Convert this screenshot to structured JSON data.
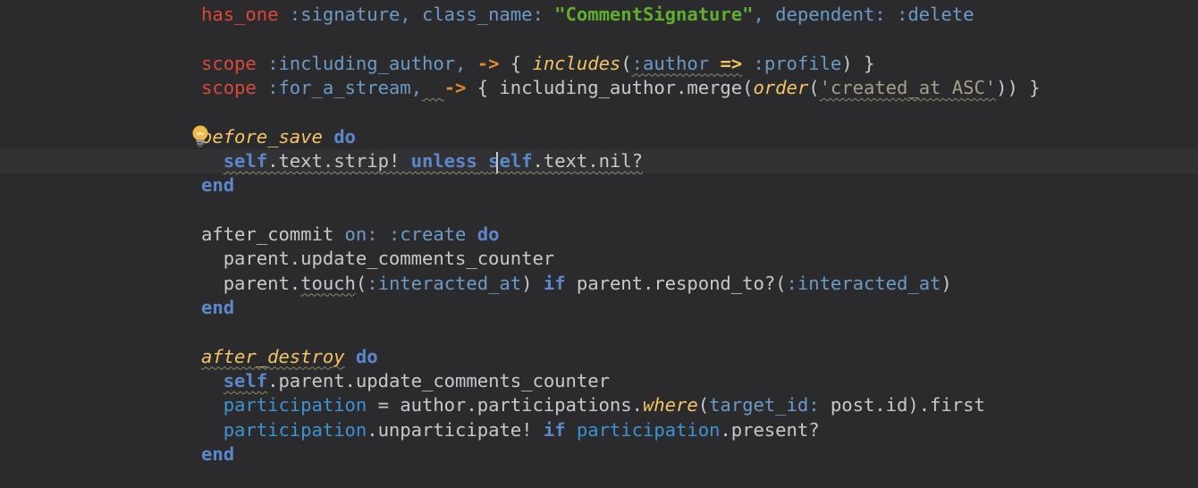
{
  "editor": {
    "current_line": 6,
    "lines": [
      [
        {
          "t": "has_one",
          "c": "kw"
        },
        {
          "t": " :signature, class_name: ",
          "c": "sym"
        },
        {
          "t": "\"CommentSignature\"",
          "c": "str"
        },
        {
          "t": ", dependent: :delete",
          "c": "sym"
        }
      ],
      [],
      [
        {
          "t": "scope",
          "c": "kw"
        },
        {
          "t": " :including_author, ",
          "c": "sym"
        },
        {
          "t": "->",
          "c": "arrow"
        },
        {
          "t": " { ",
          "c": "txt"
        },
        {
          "t": "includes",
          "c": "meth"
        },
        {
          "t": "(",
          "c": "txt"
        },
        {
          "t": ":author ",
          "c": "sym wavy"
        },
        {
          "t": "=>",
          "c": "fat wavy"
        },
        {
          "t": " :profile",
          "c": "sym"
        },
        {
          "t": ") }",
          "c": "txt"
        }
      ],
      [
        {
          "t": "scope",
          "c": "kw"
        },
        {
          "t": " :for_a_stream,",
          "c": "sym"
        },
        {
          "t": "  ",
          "c": "txt wavy"
        },
        {
          "t": "->",
          "c": "arrow"
        },
        {
          "t": " { including_author.merge(",
          "c": "txt"
        },
        {
          "t": "order",
          "c": "meth"
        },
        {
          "t": "(",
          "c": "txt"
        },
        {
          "t": "'created_at ASC'",
          "c": "sq wavy"
        },
        {
          "t": ")) }",
          "c": "txt"
        }
      ],
      [],
      [
        {
          "t": "before_save",
          "c": "meth"
        },
        {
          "t": " ",
          "c": "txt"
        },
        {
          "t": "do",
          "c": "bkw"
        }
      ],
      [
        {
          "t": "  ",
          "c": "txt"
        },
        {
          "t": "self",
          "c": "bkw wavy"
        },
        {
          "t": ".text.strip! ",
          "c": "txt wavy"
        },
        {
          "t": "unless",
          "c": "bkw wavy"
        },
        {
          "t": " ",
          "c": "txt wavy"
        },
        {
          "t": "self",
          "c": "bkw wavy"
        },
        {
          "t": ".text.nil?",
          "c": "txt wavy"
        }
      ],
      [
        {
          "t": "end",
          "c": "bkw"
        }
      ],
      [],
      [
        {
          "t": "after_commit ",
          "c": "txt"
        },
        {
          "t": "on:",
          "c": "sym"
        },
        {
          "t": " :create ",
          "c": "sym"
        },
        {
          "t": "do",
          "c": "bkw"
        }
      ],
      [
        {
          "t": "  parent.update_comments_counter",
          "c": "txt"
        }
      ],
      [
        {
          "t": "  parent.",
          "c": "txt"
        },
        {
          "t": "touch",
          "c": "txt wavy"
        },
        {
          "t": "(",
          "c": "txt"
        },
        {
          "t": ":interacted_at",
          "c": "sym"
        },
        {
          "t": ") ",
          "c": "txt"
        },
        {
          "t": "if",
          "c": "bkw"
        },
        {
          "t": " parent.respond_to?(",
          "c": "txt"
        },
        {
          "t": ":interacted_at",
          "c": "sym"
        },
        {
          "t": ")",
          "c": "txt"
        }
      ],
      [
        {
          "t": "end",
          "c": "bkw"
        }
      ],
      [],
      [
        {
          "t": "after_destroy",
          "c": "meth wavy"
        },
        {
          "t": " ",
          "c": "txt"
        },
        {
          "t": "do",
          "c": "bkw"
        }
      ],
      [
        {
          "t": "  ",
          "c": "txt"
        },
        {
          "t": "self",
          "c": "bkw wavy"
        },
        {
          "t": ".parent.update_comments_counter",
          "c": "txt"
        }
      ],
      [
        {
          "t": "  ",
          "c": "txt"
        },
        {
          "t": "participation",
          "c": "var"
        },
        {
          "t": " = author.participations.",
          "c": "txt"
        },
        {
          "t": "where",
          "c": "meth"
        },
        {
          "t": "(",
          "c": "txt"
        },
        {
          "t": "target_id:",
          "c": "sym"
        },
        {
          "t": " post.id).first",
          "c": "txt"
        }
      ],
      [
        {
          "t": "  ",
          "c": "txt"
        },
        {
          "t": "participation",
          "c": "var"
        },
        {
          "t": ".unparticipate! ",
          "c": "txt"
        },
        {
          "t": "if",
          "c": "bkw"
        },
        {
          "t": " ",
          "c": "txt"
        },
        {
          "t": "participation",
          "c": "var"
        },
        {
          "t": ".present?",
          "c": "txt"
        }
      ],
      [
        {
          "t": "end",
          "c": "bkw"
        }
      ]
    ]
  }
}
